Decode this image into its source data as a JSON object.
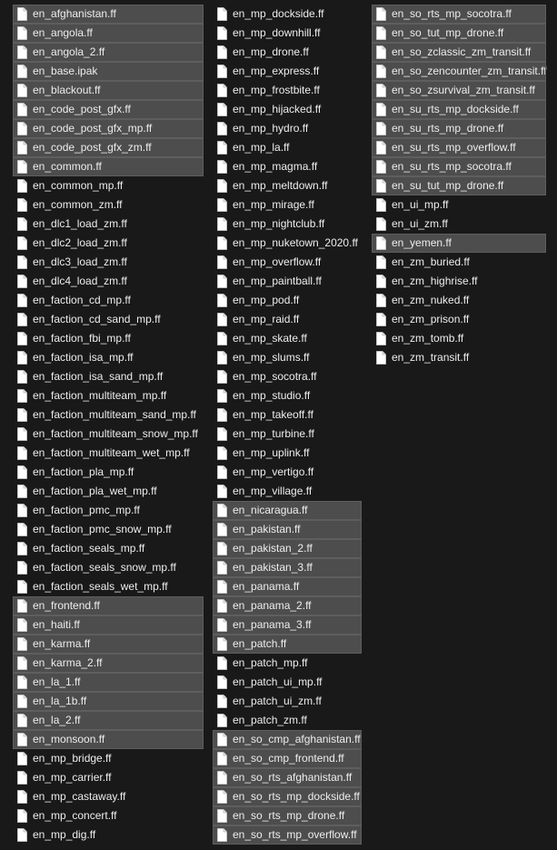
{
  "columns": [
    {
      "files": [
        {
          "name": "en_afghanistan.ff",
          "selected": true
        },
        {
          "name": "en_angola.ff",
          "selected": true
        },
        {
          "name": "en_angola_2.ff",
          "selected": true
        },
        {
          "name": "en_base.ipak",
          "selected": true
        },
        {
          "name": "en_blackout.ff",
          "selected": true
        },
        {
          "name": "en_code_post_gfx.ff",
          "selected": true
        },
        {
          "name": "en_code_post_gfx_mp.ff",
          "selected": true
        },
        {
          "name": "en_code_post_gfx_zm.ff",
          "selected": true
        },
        {
          "name": "en_common.ff",
          "selected": true
        },
        {
          "name": "en_common_mp.ff",
          "selected": false
        },
        {
          "name": "en_common_zm.ff",
          "selected": false
        },
        {
          "name": "en_dlc1_load_zm.ff",
          "selected": false
        },
        {
          "name": "en_dlc2_load_zm.ff",
          "selected": false
        },
        {
          "name": "en_dlc3_load_zm.ff",
          "selected": false
        },
        {
          "name": "en_dlc4_load_zm.ff",
          "selected": false
        },
        {
          "name": "en_faction_cd_mp.ff",
          "selected": false
        },
        {
          "name": "en_faction_cd_sand_mp.ff",
          "selected": false
        },
        {
          "name": "en_faction_fbi_mp.ff",
          "selected": false
        },
        {
          "name": "en_faction_isa_mp.ff",
          "selected": false
        },
        {
          "name": "en_faction_isa_sand_mp.ff",
          "selected": false
        },
        {
          "name": "en_faction_multiteam_mp.ff",
          "selected": false
        },
        {
          "name": "en_faction_multiteam_sand_mp.ff",
          "selected": false
        },
        {
          "name": "en_faction_multiteam_snow_mp.ff",
          "selected": false
        },
        {
          "name": "en_faction_multiteam_wet_mp.ff",
          "selected": false
        },
        {
          "name": "en_faction_pla_mp.ff",
          "selected": false
        },
        {
          "name": "en_faction_pla_wet_mp.ff",
          "selected": false
        },
        {
          "name": "en_faction_pmc_mp.ff",
          "selected": false
        },
        {
          "name": "en_faction_pmc_snow_mp.ff",
          "selected": false
        },
        {
          "name": "en_faction_seals_mp.ff",
          "selected": false
        },
        {
          "name": "en_faction_seals_snow_mp.ff",
          "selected": false
        },
        {
          "name": "en_faction_seals_wet_mp.ff",
          "selected": false
        },
        {
          "name": "en_frontend.ff",
          "selected": true
        },
        {
          "name": "en_haiti.ff",
          "selected": true
        },
        {
          "name": "en_karma.ff",
          "selected": true
        },
        {
          "name": "en_karma_2.ff",
          "selected": true
        },
        {
          "name": "en_la_1.ff",
          "selected": true
        },
        {
          "name": "en_la_1b.ff",
          "selected": true
        },
        {
          "name": "en_la_2.ff",
          "selected": true
        },
        {
          "name": "en_monsoon.ff",
          "selected": true
        },
        {
          "name": "en_mp_bridge.ff",
          "selected": false
        },
        {
          "name": "en_mp_carrier.ff",
          "selected": false
        },
        {
          "name": "en_mp_castaway.ff",
          "selected": false
        },
        {
          "name": "en_mp_concert.ff",
          "selected": false
        },
        {
          "name": "en_mp_dig.ff",
          "selected": false
        }
      ]
    },
    {
      "files": [
        {
          "name": "en_mp_dockside.ff",
          "selected": false
        },
        {
          "name": "en_mp_downhill.ff",
          "selected": false
        },
        {
          "name": "en_mp_drone.ff",
          "selected": false
        },
        {
          "name": "en_mp_express.ff",
          "selected": false
        },
        {
          "name": "en_mp_frostbite.ff",
          "selected": false
        },
        {
          "name": "en_mp_hijacked.ff",
          "selected": false
        },
        {
          "name": "en_mp_hydro.ff",
          "selected": false
        },
        {
          "name": "en_mp_la.ff",
          "selected": false
        },
        {
          "name": "en_mp_magma.ff",
          "selected": false
        },
        {
          "name": "en_mp_meltdown.ff",
          "selected": false
        },
        {
          "name": "en_mp_mirage.ff",
          "selected": false
        },
        {
          "name": "en_mp_nightclub.ff",
          "selected": false
        },
        {
          "name": "en_mp_nuketown_2020.ff",
          "selected": false
        },
        {
          "name": "en_mp_overflow.ff",
          "selected": false
        },
        {
          "name": "en_mp_paintball.ff",
          "selected": false
        },
        {
          "name": "en_mp_pod.ff",
          "selected": false
        },
        {
          "name": "en_mp_raid.ff",
          "selected": false
        },
        {
          "name": "en_mp_skate.ff",
          "selected": false
        },
        {
          "name": "en_mp_slums.ff",
          "selected": false
        },
        {
          "name": "en_mp_socotra.ff",
          "selected": false
        },
        {
          "name": "en_mp_studio.ff",
          "selected": false
        },
        {
          "name": "en_mp_takeoff.ff",
          "selected": false
        },
        {
          "name": "en_mp_turbine.ff",
          "selected": false
        },
        {
          "name": "en_mp_uplink.ff",
          "selected": false
        },
        {
          "name": "en_mp_vertigo.ff",
          "selected": false
        },
        {
          "name": "en_mp_village.ff",
          "selected": false
        },
        {
          "name": "en_nicaragua.ff",
          "selected": true
        },
        {
          "name": "en_pakistan.ff",
          "selected": true
        },
        {
          "name": "en_pakistan_2.ff",
          "selected": true
        },
        {
          "name": "en_pakistan_3.ff",
          "selected": true
        },
        {
          "name": "en_panama.ff",
          "selected": true
        },
        {
          "name": "en_panama_2.ff",
          "selected": true
        },
        {
          "name": "en_panama_3.ff",
          "selected": true
        },
        {
          "name": "en_patch.ff",
          "selected": true
        },
        {
          "name": "en_patch_mp.ff",
          "selected": false
        },
        {
          "name": "en_patch_ui_mp.ff",
          "selected": false
        },
        {
          "name": "en_patch_ui_zm.ff",
          "selected": false
        },
        {
          "name": "en_patch_zm.ff",
          "selected": false
        },
        {
          "name": "en_so_cmp_afghanistan.ff",
          "selected": true
        },
        {
          "name": "en_so_cmp_frontend.ff",
          "selected": true
        },
        {
          "name": "en_so_rts_afghanistan.ff",
          "selected": true
        },
        {
          "name": "en_so_rts_mp_dockside.ff",
          "selected": true
        },
        {
          "name": "en_so_rts_mp_drone.ff",
          "selected": true
        },
        {
          "name": "en_so_rts_mp_overflow.ff",
          "selected": true
        }
      ]
    },
    {
      "files": [
        {
          "name": "en_so_rts_mp_socotra.ff",
          "selected": true
        },
        {
          "name": "en_so_tut_mp_drone.ff",
          "selected": true
        },
        {
          "name": "en_so_zclassic_zm_transit.ff",
          "selected": true
        },
        {
          "name": "en_so_zencounter_zm_transit.ff",
          "selected": true
        },
        {
          "name": "en_so_zsurvival_zm_transit.ff",
          "selected": true
        },
        {
          "name": "en_su_rts_mp_dockside.ff",
          "selected": true
        },
        {
          "name": "en_su_rts_mp_drone.ff",
          "selected": true
        },
        {
          "name": "en_su_rts_mp_overflow.ff",
          "selected": true
        },
        {
          "name": "en_su_rts_mp_socotra.ff",
          "selected": true
        },
        {
          "name": "en_su_tut_mp_drone.ff",
          "selected": true
        },
        {
          "name": "en_ui_mp.ff",
          "selected": false
        },
        {
          "name": "en_ui_zm.ff",
          "selected": false
        },
        {
          "name": "en_yemen.ff",
          "selected": true
        },
        {
          "name": "en_zm_buried.ff",
          "selected": false
        },
        {
          "name": "en_zm_highrise.ff",
          "selected": false
        },
        {
          "name": "en_zm_nuked.ff",
          "selected": false
        },
        {
          "name": "en_zm_prison.ff",
          "selected": false
        },
        {
          "name": "en_zm_tomb.ff",
          "selected": false
        },
        {
          "name": "en_zm_transit.ff",
          "selected": false
        }
      ]
    }
  ],
  "icon": "generic-file-icon",
  "colors": {
    "background": "#191919",
    "selected_background": "#4d4d4d",
    "selected_border": "#5e5e5e",
    "text": "#ededed",
    "icon_fill": "#ffffff"
  }
}
